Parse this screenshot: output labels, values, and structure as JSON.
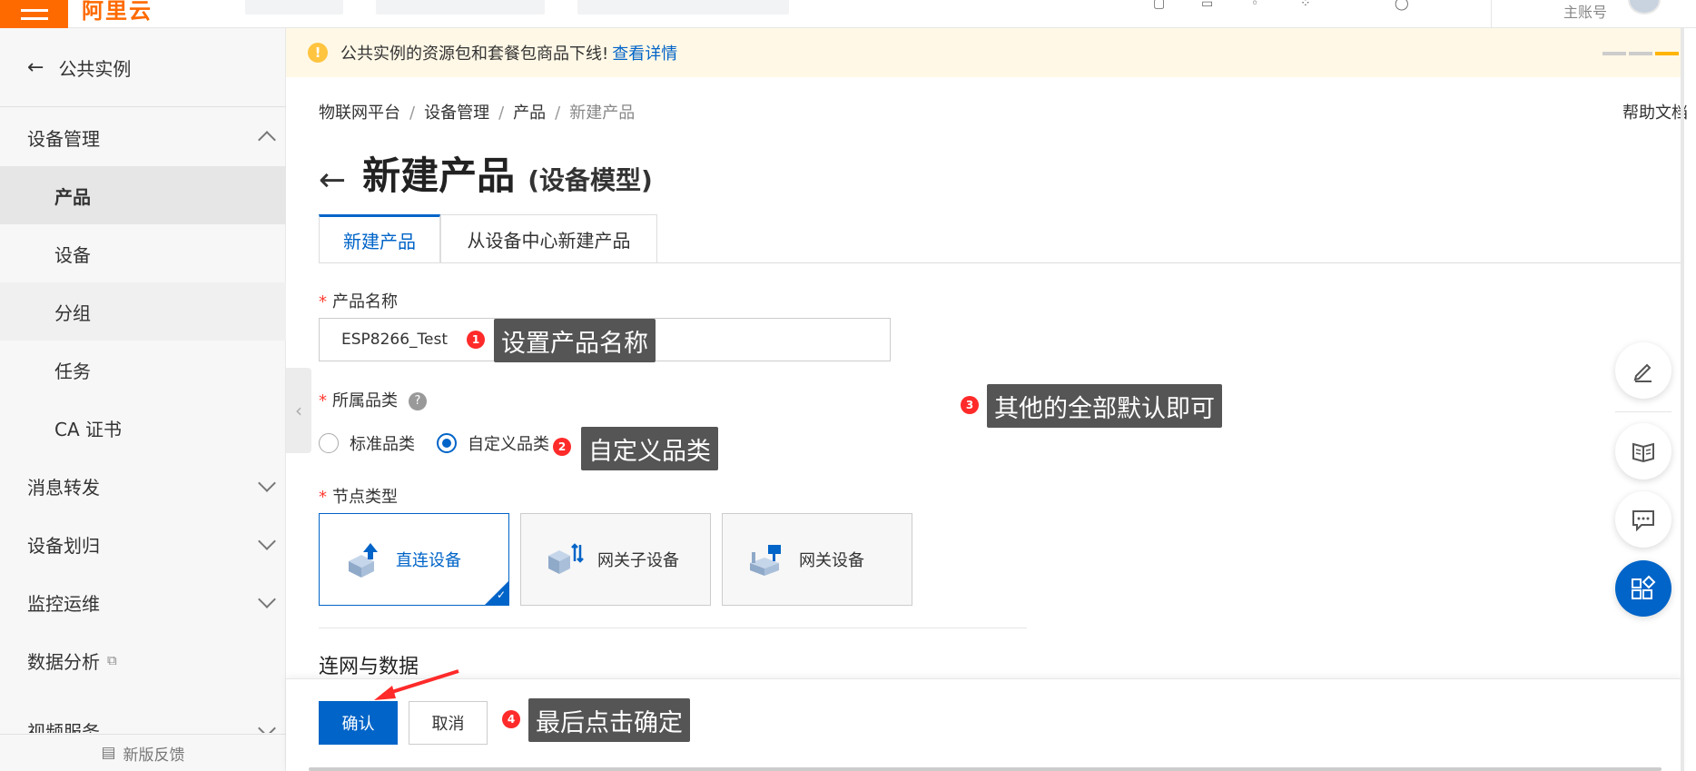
{
  "topbar": {
    "logo": "阿里云",
    "account": "主账号"
  },
  "sidebar": {
    "back_label": "公共实例",
    "items": [
      {
        "label": "设备管理",
        "level": "top",
        "expanded": true
      },
      {
        "label": "产品",
        "level": "sub",
        "active": true
      },
      {
        "label": "设备",
        "level": "sub"
      },
      {
        "label": "分组",
        "level": "sub"
      },
      {
        "label": "任务",
        "level": "sub"
      },
      {
        "label": "CA 证书",
        "level": "sub"
      },
      {
        "label": "消息转发",
        "level": "top"
      },
      {
        "label": "设备划归",
        "level": "top"
      },
      {
        "label": "监控运维",
        "level": "top"
      },
      {
        "label": "数据分析",
        "level": "top",
        "external": true
      },
      {
        "label": "视频服务",
        "level": "top"
      }
    ],
    "feedback": "新版反馈"
  },
  "notice": {
    "text": "公共实例的资源包和套餐包商品下线!",
    "link": "查看详情"
  },
  "breadcrumb": [
    "物联网平台",
    "设备管理",
    "产品",
    "新建产品"
  ],
  "help_label": "帮助文档",
  "page": {
    "title": "新建产品",
    "subtitle": "(设备模型)"
  },
  "tabs": [
    {
      "label": "新建产品",
      "active": true
    },
    {
      "label": "从设备中心新建产品",
      "active": false
    }
  ],
  "form": {
    "product_name_label": "产品名称",
    "product_name_value": "ESP8266_Test",
    "category_label": "所属品类",
    "category_options": [
      "标准品类",
      "自定义品类"
    ],
    "category_selected": "自定义品类",
    "node_type_label": "节点类型",
    "node_types": [
      {
        "label": "直连设备",
        "selected": true
      },
      {
        "label": "网关子设备",
        "selected": false
      },
      {
        "label": "网关设备",
        "selected": false
      }
    ],
    "section_title": "连网与数据"
  },
  "footer": {
    "confirm": "确认",
    "cancel": "取消"
  },
  "annotations": [
    {
      "num": "1",
      "text": "设置产品名称"
    },
    {
      "num": "2",
      "text": "自定义品类"
    },
    {
      "num": "3",
      "text": "其他的全部默认即可"
    },
    {
      "num": "4",
      "text": "最后点击确定"
    }
  ],
  "colors": {
    "brand": "#ff6a00",
    "primary": "#0064c8",
    "annotation_red": "#ff2a2a"
  }
}
